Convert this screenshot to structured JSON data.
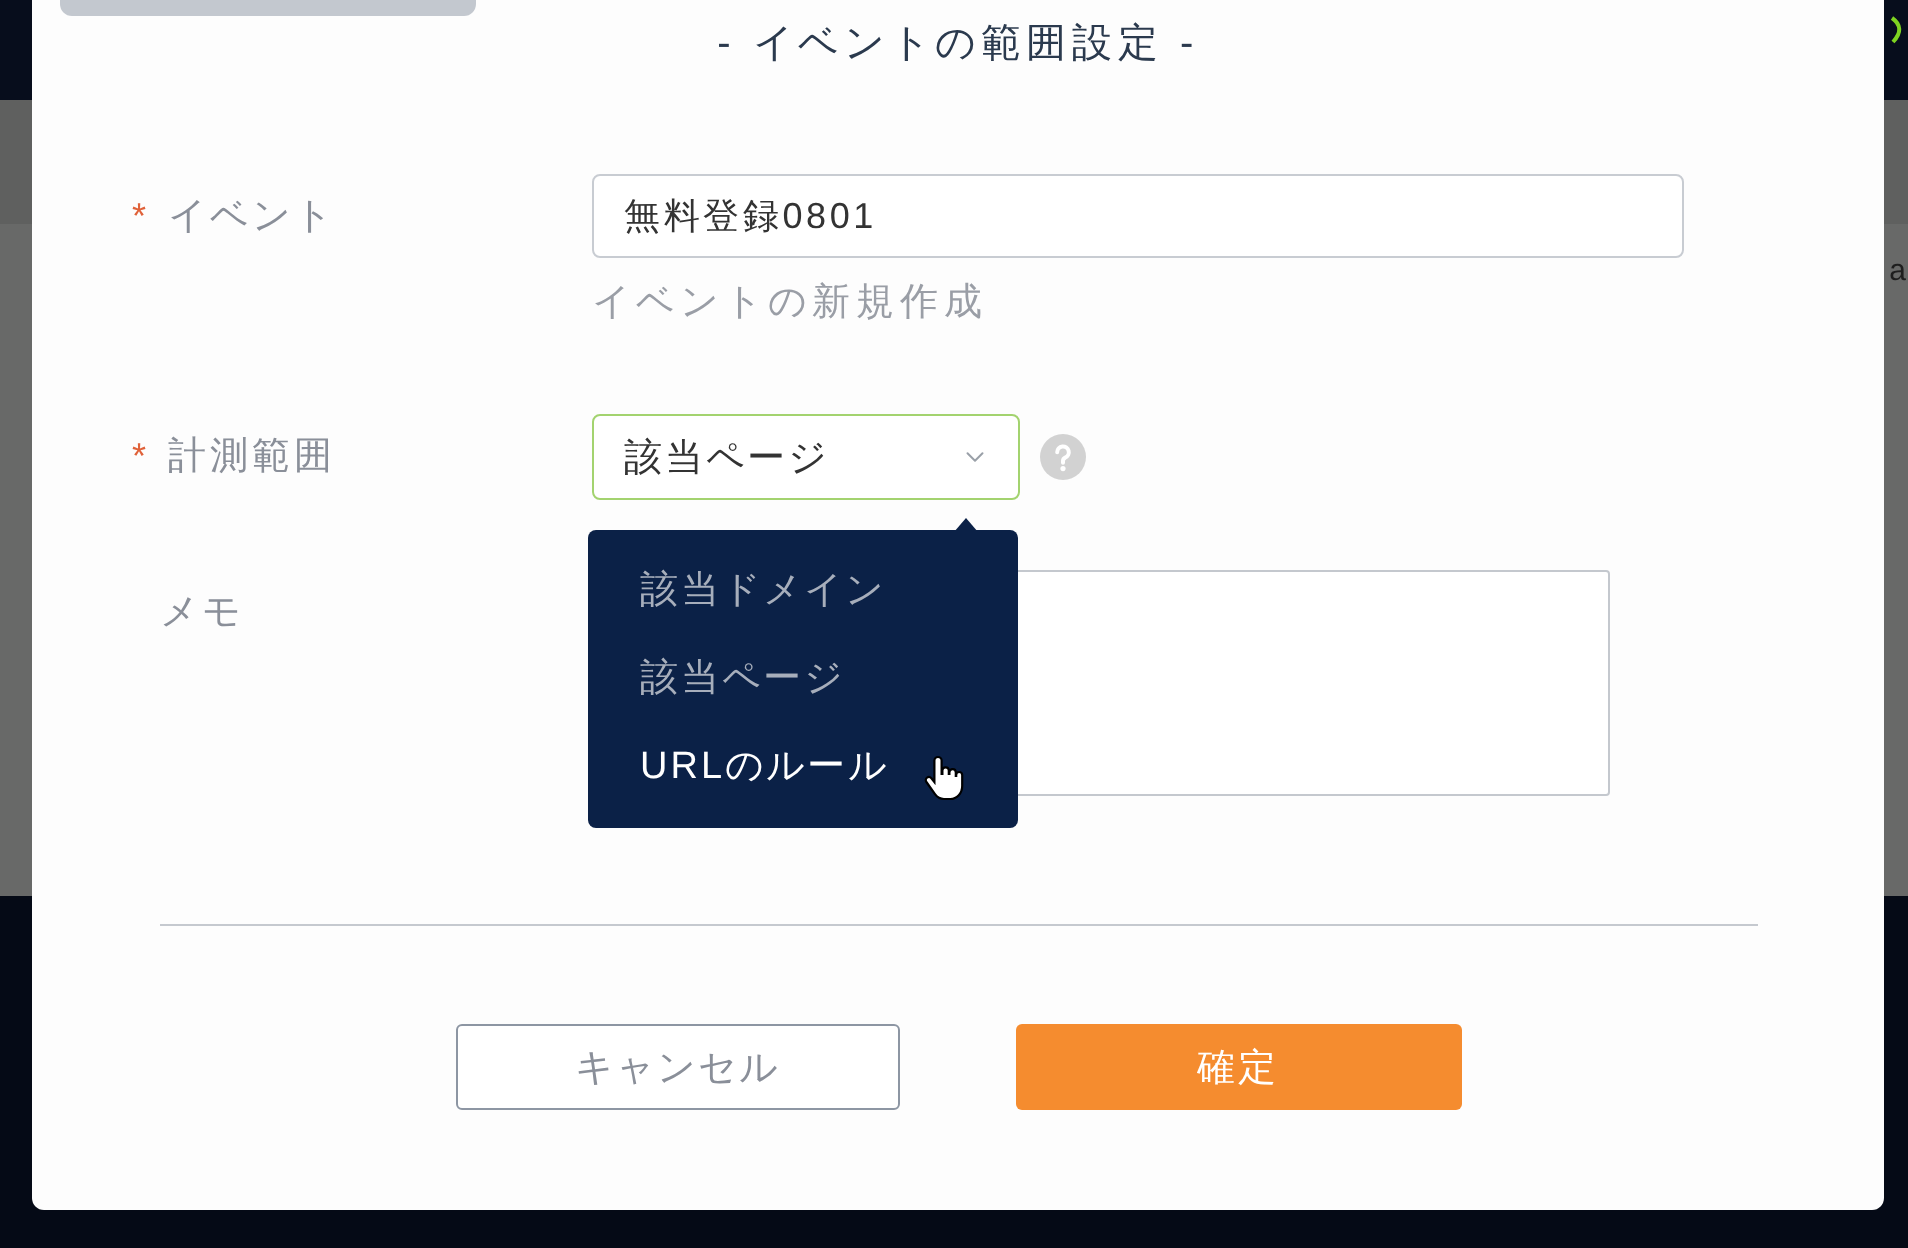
{
  "dialog": {
    "title": "- イベントの範囲設定 -"
  },
  "fields": [
    {
      "kind": "input",
      "required_mark": "*",
      "label": "イベント",
      "value": "無料登録0801",
      "link": "イベントの新規作成"
    },
    {
      "kind": "select",
      "required_mark": "*",
      "label": "計測範囲",
      "value": "該当ページ",
      "focused": true,
      "help": true,
      "open": true,
      "options": [
        {
          "label": "該当ドメイン",
          "hovered": false
        },
        {
          "label": "該当ページ",
          "hovered": false
        },
        {
          "label": "URLのルール",
          "hovered": true
        }
      ]
    },
    {
      "kind": "textarea",
      "label": "メモ"
    }
  ],
  "buttons": [
    {
      "kind": "secondary",
      "label": "キャンセル"
    },
    {
      "kind": "primary",
      "label": "確定"
    }
  ],
  "background": {
    "edge_text": "a"
  }
}
